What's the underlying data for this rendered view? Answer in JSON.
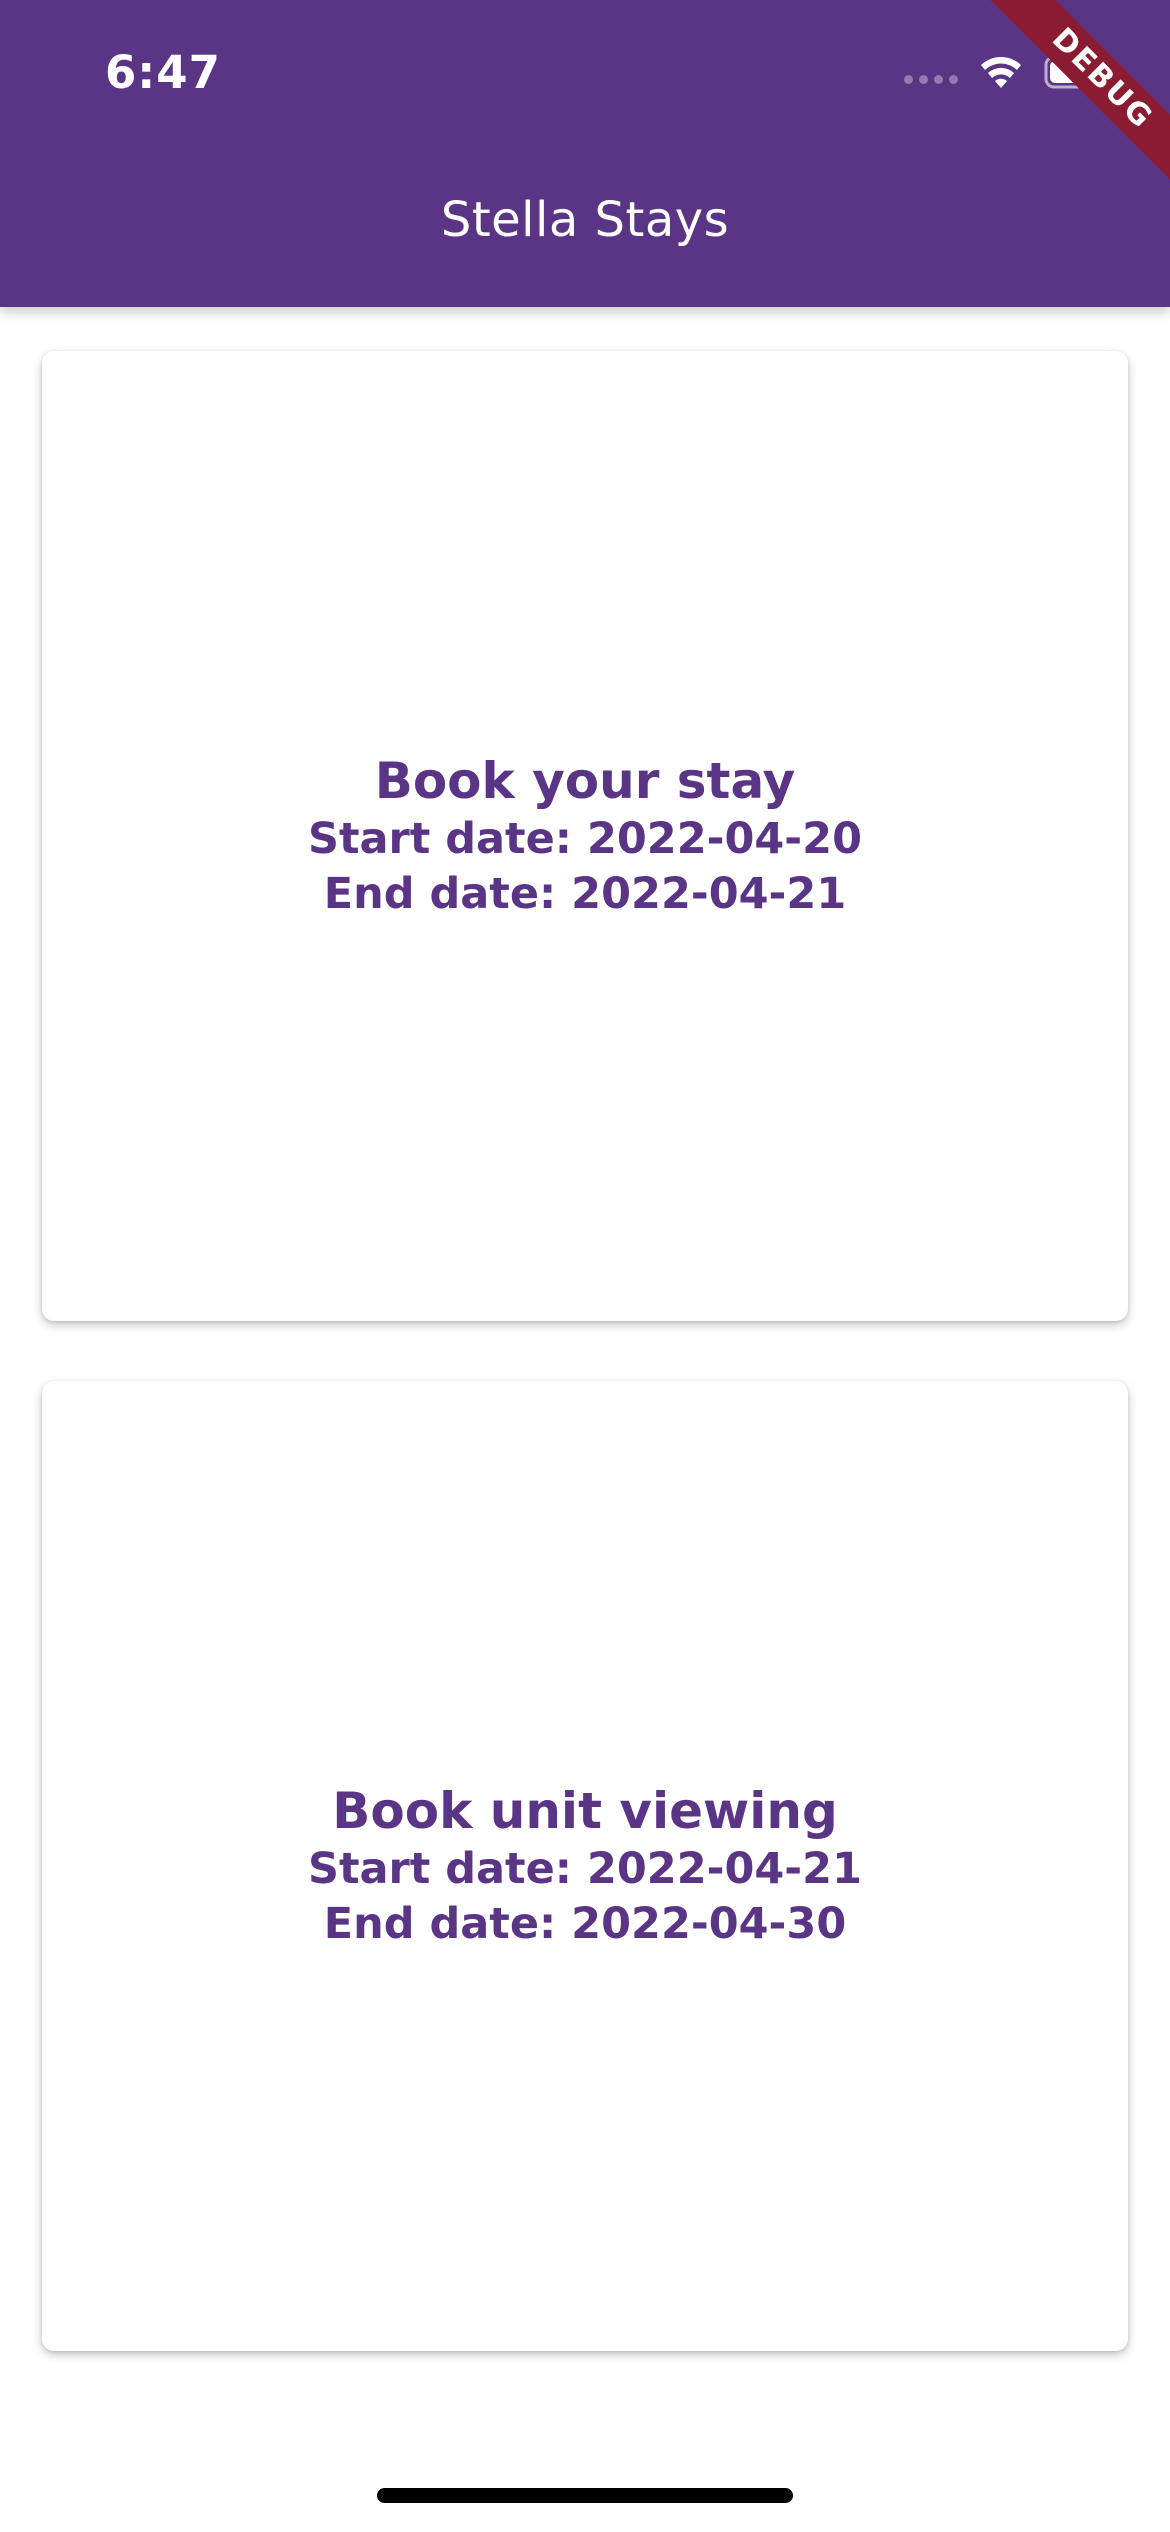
{
  "status_bar": {
    "time": "6:47",
    "icons": [
      "signal-dots",
      "wifi-icon",
      "battery-icon"
    ]
  },
  "app_bar": {
    "title": "Stella Stays",
    "color": "#5a3585"
  },
  "debug_banner": {
    "label": "DEBUG",
    "color": "#8a1b30"
  },
  "cards": [
    {
      "title": "Book your stay",
      "start_date": "Start date: 2022-04-20",
      "end_date": "End date: 2022-04-21"
    },
    {
      "title": "Book unit viewing",
      "start_date": "Start date: 2022-04-21",
      "end_date": "End date: 2022-04-30"
    }
  ],
  "accent_color": "#5a3585"
}
